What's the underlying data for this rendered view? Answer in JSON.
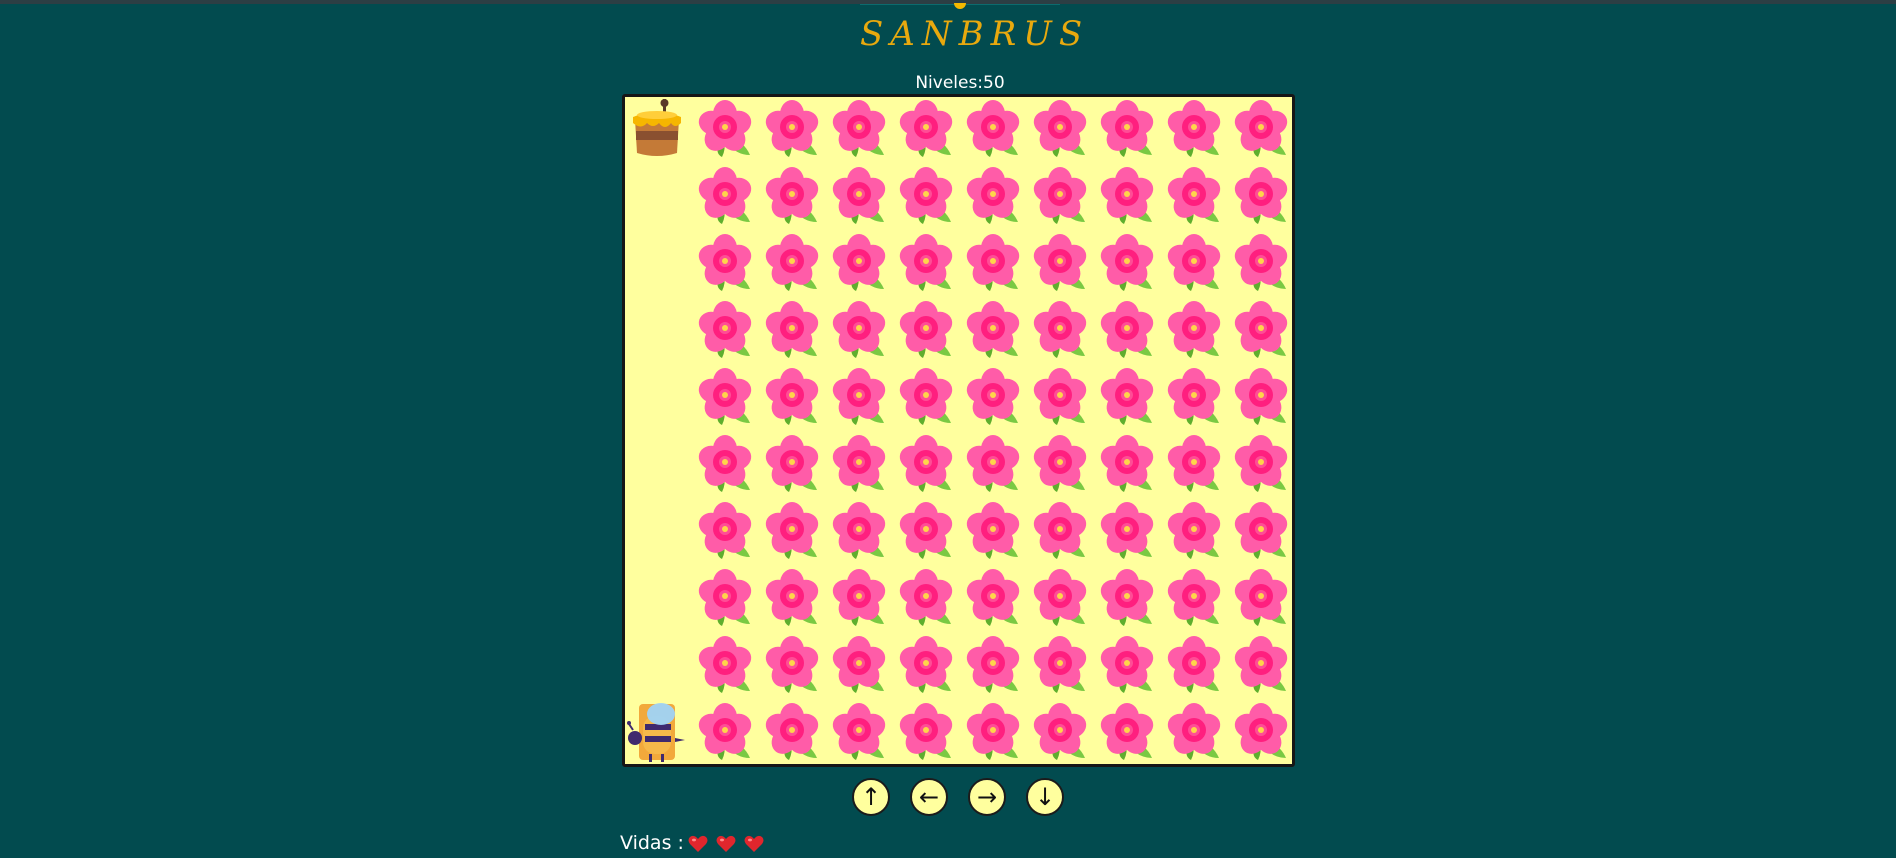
{
  "title": "SANBRUS",
  "level": {
    "text": "Niveles:50"
  },
  "board": {
    "rows": 10,
    "cols": 10,
    "cells": [
      [
        "honey",
        "flower",
        "flower",
        "flower",
        "flower",
        "flower",
        "flower",
        "flower",
        "flower",
        "flower"
      ],
      [
        "empty",
        "flower",
        "flower",
        "flower",
        "flower",
        "flower",
        "flower",
        "flower",
        "flower",
        "flower"
      ],
      [
        "empty",
        "flower",
        "flower",
        "flower",
        "flower",
        "flower",
        "flower",
        "flower",
        "flower",
        "flower"
      ],
      [
        "empty",
        "flower",
        "flower",
        "flower",
        "flower",
        "flower",
        "flower",
        "flower",
        "flower",
        "flower"
      ],
      [
        "empty",
        "flower",
        "flower",
        "flower",
        "flower",
        "flower",
        "flower",
        "flower",
        "flower",
        "flower"
      ],
      [
        "empty",
        "flower",
        "flower",
        "flower",
        "flower",
        "flower",
        "flower",
        "flower",
        "flower",
        "flower"
      ],
      [
        "empty",
        "flower",
        "flower",
        "flower",
        "flower",
        "flower",
        "flower",
        "flower",
        "flower",
        "flower"
      ],
      [
        "empty",
        "flower",
        "flower",
        "flower",
        "flower",
        "flower",
        "flower",
        "flower",
        "flower",
        "flower"
      ],
      [
        "empty",
        "flower",
        "flower",
        "flower",
        "flower",
        "flower",
        "flower",
        "flower",
        "flower",
        "flower"
      ],
      [
        "bee",
        "flower",
        "flower",
        "flower",
        "flower",
        "flower",
        "flower",
        "flower",
        "flower",
        "flower"
      ]
    ]
  },
  "controls": {
    "up": "↑",
    "left": "←",
    "right": "→",
    "down": "↓"
  },
  "lives": {
    "label": "Vidas :",
    "count": 3
  },
  "colors": {
    "background": "#024b4f",
    "board": "#ffff9e",
    "title": "#e8a90e",
    "petal": "#ff5ca8",
    "petal_inner": "#ff1f7f",
    "leaf": "#7ac943",
    "heart": "#e0262d"
  },
  "icons": {
    "flower": "hibiscus-icon",
    "honey": "honey-pot-icon",
    "bee": "bee-icon",
    "heart": "heart-icon"
  }
}
